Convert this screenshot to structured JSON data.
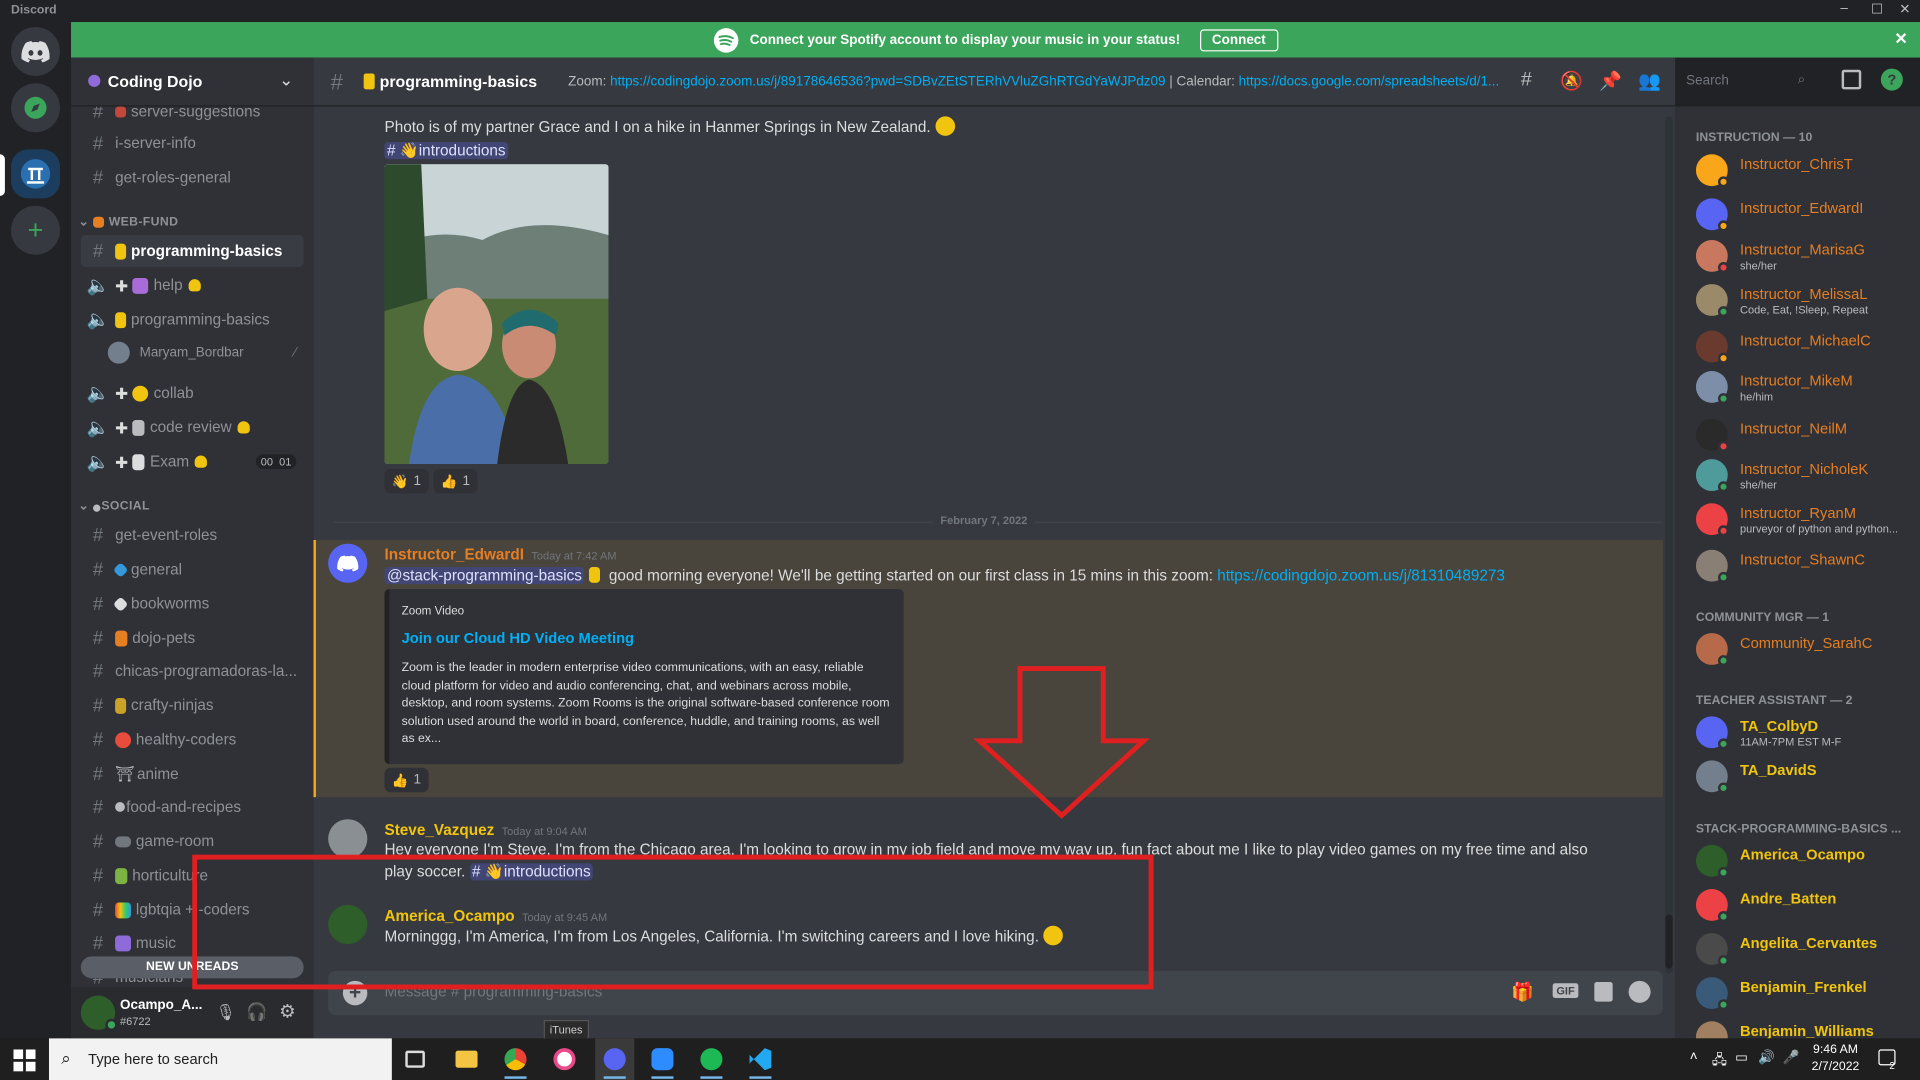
{
  "window": {
    "title": "Discord"
  },
  "banner": {
    "text": "Connect your Spotify account to display your music in your status!",
    "button": "Connect"
  },
  "server": {
    "name": "Coding Dojo"
  },
  "sidebar": {
    "channels_top": [
      {
        "name": "server-suggestions"
      },
      {
        "name": "i-server-info"
      },
      {
        "name": "get-roles-general"
      }
    ],
    "cat_webfund": "WEB-FUND",
    "webfund": [
      {
        "name": "programming-basics"
      },
      {
        "name": "help"
      },
      {
        "name": "programming-basics"
      },
      {
        "name": "Maryam_Bordbar"
      },
      {
        "name": "collab"
      },
      {
        "name": "code review"
      },
      {
        "name": "Exam",
        "badge1": "00",
        "badge2": "01"
      }
    ],
    "cat_social": "SOCIAL",
    "social": [
      {
        "name": "get-event-roles"
      },
      {
        "name": "general"
      },
      {
        "name": "bookworms"
      },
      {
        "name": "dojo-pets"
      },
      {
        "name": "chicas-programadoras-la..."
      },
      {
        "name": "crafty-ninjas"
      },
      {
        "name": "healthy-coders"
      },
      {
        "name": "anime"
      },
      {
        "name": "food-and-recipes"
      },
      {
        "name": "game-room"
      },
      {
        "name": "horticulture"
      },
      {
        "name": "lgbtqia + -coders"
      },
      {
        "name": "music"
      },
      {
        "name": "musicians"
      }
    ],
    "new_unreads": "NEW UNREADS"
  },
  "user": {
    "name": "Ocampo_A...",
    "tag": "#6722"
  },
  "channel": {
    "name": "programming-basics",
    "topic_prefix": "Zoom: ",
    "topic_zoom": "https://codingdojo.zoom.us/j/89178646536?pwd=SDBvZEtSTERhVVluZGhRTGdYaWJPdz09",
    "topic_mid": " | Calendar: ",
    "topic_cal": "https://docs.google.com/spreadsheets/d/1...",
    "search_placeholder": "Search",
    "message_placeholder": "Message #  programming-basics"
  },
  "messages": {
    "m0": {
      "text": "Photo is of my partner Grace and I on a hike in Hanmer Springs in New Zealand.",
      "channel_mention": "introductions",
      "r1": "1",
      "r2": "1"
    },
    "divider": "February 7, 2022",
    "m1": {
      "author": "Instructor_EdwardI",
      "time": "Today at 7:42 AM",
      "mention": "@stack-programming-basics",
      "text": " good morning everyone! We'll be getting started on our first class in 15 mins in this zoom: ",
      "link": "https://codingdojo.zoom.us/j/81310489273",
      "embed": {
        "provider": "Zoom Video",
        "title": "Join our Cloud HD Video Meeting",
        "desc": "Zoom is the leader in modern enterprise video communications, with an easy, reliable cloud platform for video and audio conferencing, chat, and webinars across mobile, desktop, and room systems. Zoom Rooms is the original software-based conference room solution used around the world in board, conference, huddle, and training rooms, as well as ex..."
      },
      "r1": "1"
    },
    "m2": {
      "author": "Steve_Vazquez",
      "time": "Today at 9:04 AM",
      "text": "Hey everyone I'm Steve, I'm from the Chicago area, I'm looking to grow in my job field and move my way up. fun fact about me I like to play video games on my free time and also play soccer.",
      "channel_mention": "introductions"
    },
    "m3": {
      "author": "America_Ocampo",
      "time": "Today at 9:45 AM",
      "text": "Morninggg, I'm America, I'm from Los Angeles, California. I'm switching careers and I love hiking."
    }
  },
  "members": {
    "cat_instruction": "INSTRUCTION — 10",
    "instruction": [
      {
        "name": "Instructor_ChrisT",
        "sub": ""
      },
      {
        "name": "Instructor_EdwardI",
        "sub": ""
      },
      {
        "name": "Instructor_MarisaG",
        "sub": "she/her"
      },
      {
        "name": "Instructor_MelissaL",
        "sub": "Code, Eat, !Sleep, Repeat"
      },
      {
        "name": "Instructor_MichaelC",
        "sub": ""
      },
      {
        "name": "Instructor_MikeM",
        "sub": "he/him"
      },
      {
        "name": "Instructor_NeilM",
        "sub": ""
      },
      {
        "name": "Instructor_NicholeK",
        "sub": "she/her"
      },
      {
        "name": "Instructor_RyanM",
        "sub": "purveyor of python and python..."
      },
      {
        "name": "Instructor_ShawnC",
        "sub": ""
      }
    ],
    "cat_community": "COMMUNITY MGR — 1",
    "community": [
      {
        "name": "Community_SarahC",
        "sub": ""
      }
    ],
    "cat_ta": "TEACHER ASSISTANT — 2",
    "ta": [
      {
        "name": "TA_ColbyD",
        "sub": "11AM-7PM EST M-F"
      },
      {
        "name": "TA_DavidS",
        "sub": ""
      }
    ],
    "cat_stack": "STACK-PROGRAMMING-BASICS ...",
    "stack": [
      {
        "name": "America_Ocampo"
      },
      {
        "name": "Andre_Batten"
      },
      {
        "name": "Angelita_Cervantes"
      },
      {
        "name": "Benjamin_Frenkel"
      },
      {
        "name": "Benjamin_Williams"
      }
    ]
  },
  "taskbar": {
    "search": "Type here to search",
    "time": "9:46 AM",
    "date": "2/7/2022",
    "tooltip": "iTunes",
    "notif": "2"
  },
  "colors": {
    "instructor": "#e67e22",
    "community": "#e67e22",
    "ta": "#f1c40f",
    "stack": "#f1c40f",
    "green": "#3ba55c",
    "blurple": "#5865f2",
    "annotation": "#e02020"
  }
}
